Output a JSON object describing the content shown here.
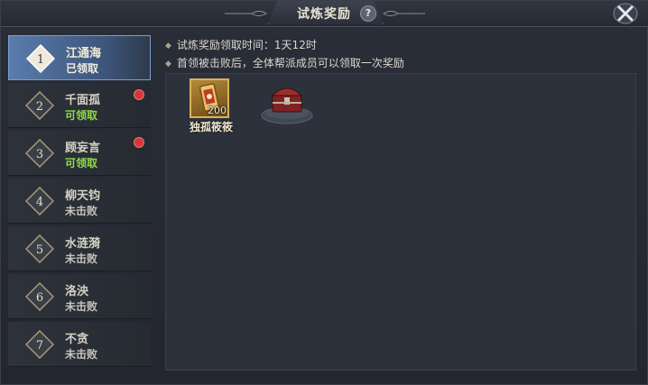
{
  "window": {
    "title": "试炼奖励",
    "help_icon": "?"
  },
  "tabs": [
    {
      "index": "1",
      "name": "江通海",
      "status": "已领取",
      "state": "claimed",
      "notify": false
    },
    {
      "index": "2",
      "name": "千面孤",
      "status": "可领取",
      "state": "available",
      "notify": true
    },
    {
      "index": "3",
      "name": "顾妄言",
      "status": "可领取",
      "state": "available",
      "notify": true
    },
    {
      "index": "4",
      "name": "柳天钧",
      "status": "未击败",
      "state": "undefeated",
      "notify": false
    },
    {
      "index": "5",
      "name": "水涟漪",
      "status": "未击败",
      "state": "undefeated",
      "notify": false
    },
    {
      "index": "6",
      "name": "洛泱",
      "status": "未击败",
      "state": "undefeated",
      "notify": false
    },
    {
      "index": "7",
      "name": "不贪",
      "status": "未击败",
      "state": "undefeated",
      "notify": false
    }
  ],
  "active_tab": 0,
  "info": {
    "line1": "试炼奖励领取时间：1天12时",
    "line2": "首领被击败后，全体帮派成员可以领取一次奖励"
  },
  "rewards": {
    "item": {
      "name": "独孤筱筱",
      "quantity": "200",
      "icon": "scroll-card-icon"
    },
    "chest": {
      "icon": "treasure-chest-icon"
    }
  },
  "colors": {
    "available": "#8ddc45",
    "active_tab": "#5a7cae",
    "notify_dot": "#d23a3a"
  }
}
